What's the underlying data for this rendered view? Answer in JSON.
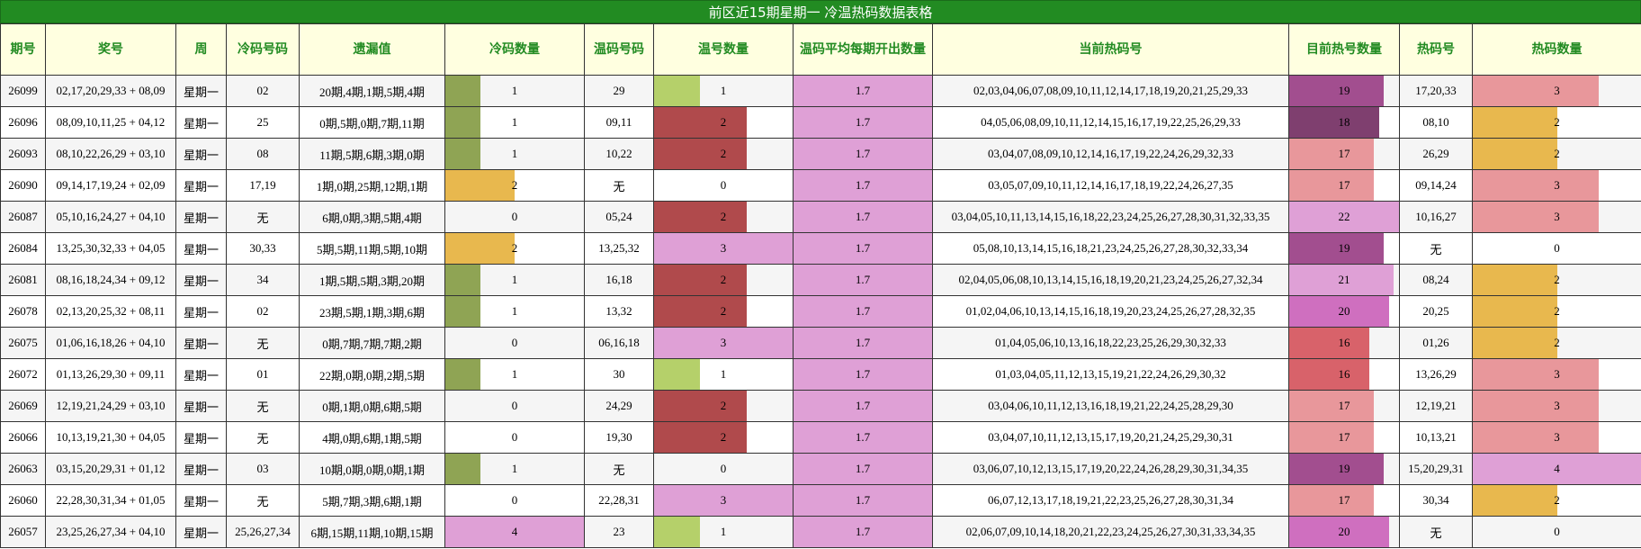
{
  "title": "前区近15期星期一 冷温热码数据表格",
  "headers": [
    "期号",
    "奖号",
    "周",
    "冷码号码",
    "遗漏值",
    "冷码数量",
    "温码号码",
    "温号数量",
    "温码平均每期开出数量",
    "当前热码号",
    "目前热号数量",
    "热码号",
    "热码数量"
  ],
  "palette": {
    "cold": {
      "1": "#8FA454",
      "2": "#E8B84E",
      "4": "#DFA0D6"
    },
    "warm": {
      "1": "#B5D06A",
      "2": "#B04A4C",
      "3": "#DFA0D6"
    },
    "warm_avg": "#DFA0D6",
    "cur_hot": {
      "16": "#D8626A",
      "17": "#E8979B",
      "18": "#7F3F6F",
      "19": "#A24E8F",
      "20": "#CF6FBF",
      "21": "#DFA0D6",
      "22": "#DFA0D6"
    },
    "hot": {
      "2": "#E8B84E",
      "3": "#E8979B",
      "4": "#DFA0D6"
    }
  },
  "chart_data": {
    "type": "table",
    "title": "前区近15期星期一 冷温热码数据表格",
    "rows": [
      {
        "issue": "26099",
        "numbers": "02,17,20,29,33 + 08,09",
        "week": "星期一",
        "cold_nums": "02",
        "omission": "20期,4期,1期,5期,4期",
        "cold_count": 1,
        "warm_nums": "29",
        "warm_count": 1,
        "warm_avg": "1.7",
        "cur_hot": "02,03,04,06,07,08,09,10,11,12,14,17,18,19,20,21,25,29,33",
        "cur_hot_count": 19,
        "hot_nums": "17,20,33",
        "hot_count": 3
      },
      {
        "issue": "26096",
        "numbers": "08,09,10,11,25 + 04,12",
        "week": "星期一",
        "cold_nums": "25",
        "omission": "0期,5期,0期,7期,11期",
        "cold_count": 1,
        "warm_nums": "09,11",
        "warm_count": 2,
        "warm_avg": "1.7",
        "cur_hot": "04,05,06,08,09,10,11,12,14,15,16,17,19,22,25,26,29,33",
        "cur_hot_count": 18,
        "hot_nums": "08,10",
        "hot_count": 2
      },
      {
        "issue": "26093",
        "numbers": "08,10,22,26,29 + 03,10",
        "week": "星期一",
        "cold_nums": "08",
        "omission": "11期,5期,6期,3期,0期",
        "cold_count": 1,
        "warm_nums": "10,22",
        "warm_count": 2,
        "warm_avg": "1.7",
        "cur_hot": "03,04,07,08,09,10,12,14,16,17,19,22,24,26,29,32,33",
        "cur_hot_count": 17,
        "hot_nums": "26,29",
        "hot_count": 2
      },
      {
        "issue": "26090",
        "numbers": "09,14,17,19,24 + 02,09",
        "week": "星期一",
        "cold_nums": "17,19",
        "omission": "1期,0期,25期,12期,1期",
        "cold_count": 2,
        "warm_nums": "无",
        "warm_count": 0,
        "warm_avg": "1.7",
        "cur_hot": "03,05,07,09,10,11,12,14,16,17,18,19,22,24,26,27,35",
        "cur_hot_count": 17,
        "hot_nums": "09,14,24",
        "hot_count": 3
      },
      {
        "issue": "26087",
        "numbers": "05,10,16,24,27 + 04,10",
        "week": "星期一",
        "cold_nums": "无",
        "omission": "6期,0期,3期,5期,4期",
        "cold_count": 0,
        "warm_nums": "05,24",
        "warm_count": 2,
        "warm_avg": "1.7",
        "cur_hot": "03,04,05,10,11,13,14,15,16,18,22,23,24,25,26,27,28,30,31,32,33,35",
        "cur_hot_count": 22,
        "hot_nums": "10,16,27",
        "hot_count": 3
      },
      {
        "issue": "26084",
        "numbers": "13,25,30,32,33 + 04,05",
        "week": "星期一",
        "cold_nums": "30,33",
        "omission": "5期,5期,11期,5期,10期",
        "cold_count": 2,
        "warm_nums": "13,25,32",
        "warm_count": 3,
        "warm_avg": "1.7",
        "cur_hot": "05,08,10,13,14,15,16,18,21,23,24,25,26,27,28,30,32,33,34",
        "cur_hot_count": 19,
        "hot_nums": "无",
        "hot_count": 0
      },
      {
        "issue": "26081",
        "numbers": "08,16,18,24,34 + 09,12",
        "week": "星期一",
        "cold_nums": "34",
        "omission": "1期,5期,5期,3期,20期",
        "cold_count": 1,
        "warm_nums": "16,18",
        "warm_count": 2,
        "warm_avg": "1.7",
        "cur_hot": "02,04,05,06,08,10,13,14,15,16,18,19,20,21,23,24,25,26,27,32,34",
        "cur_hot_count": 21,
        "hot_nums": "08,24",
        "hot_count": 2
      },
      {
        "issue": "26078",
        "numbers": "02,13,20,25,32 + 08,11",
        "week": "星期一",
        "cold_nums": "02",
        "omission": "23期,5期,1期,3期,6期",
        "cold_count": 1,
        "warm_nums": "13,32",
        "warm_count": 2,
        "warm_avg": "1.7",
        "cur_hot": "01,02,04,06,10,13,14,15,16,18,19,20,23,24,25,26,27,28,32,35",
        "cur_hot_count": 20,
        "hot_nums": "20,25",
        "hot_count": 2
      },
      {
        "issue": "26075",
        "numbers": "01,06,16,18,26 + 04,10",
        "week": "星期一",
        "cold_nums": "无",
        "omission": "0期,7期,7期,7期,2期",
        "cold_count": 0,
        "warm_nums": "06,16,18",
        "warm_count": 3,
        "warm_avg": "1.7",
        "cur_hot": "01,04,05,06,10,13,16,18,22,23,25,26,29,30,32,33",
        "cur_hot_count": 16,
        "hot_nums": "01,26",
        "hot_count": 2
      },
      {
        "issue": "26072",
        "numbers": "01,13,26,29,30 + 09,11",
        "week": "星期一",
        "cold_nums": "01",
        "omission": "22期,0期,0期,2期,5期",
        "cold_count": 1,
        "warm_nums": "30",
        "warm_count": 1,
        "warm_avg": "1.7",
        "cur_hot": "01,03,04,05,11,12,13,15,19,21,22,24,26,29,30,32",
        "cur_hot_count": 16,
        "hot_nums": "13,26,29",
        "hot_count": 3
      },
      {
        "issue": "26069",
        "numbers": "12,19,21,24,29 + 03,10",
        "week": "星期一",
        "cold_nums": "无",
        "omission": "0期,1期,0期,6期,5期",
        "cold_count": 0,
        "warm_nums": "24,29",
        "warm_count": 2,
        "warm_avg": "1.7",
        "cur_hot": "03,04,06,10,11,12,13,16,18,19,21,22,24,25,28,29,30",
        "cur_hot_count": 17,
        "hot_nums": "12,19,21",
        "hot_count": 3
      },
      {
        "issue": "26066",
        "numbers": "10,13,19,21,30 + 04,05",
        "week": "星期一",
        "cold_nums": "无",
        "omission": "4期,0期,6期,1期,5期",
        "cold_count": 0,
        "warm_nums": "19,30",
        "warm_count": 2,
        "warm_avg": "1.7",
        "cur_hot": "03,04,07,10,11,12,13,15,17,19,20,21,24,25,29,30,31",
        "cur_hot_count": 17,
        "hot_nums": "10,13,21",
        "hot_count": 3
      },
      {
        "issue": "26063",
        "numbers": "03,15,20,29,31 + 01,12",
        "week": "星期一",
        "cold_nums": "03",
        "omission": "10期,0期,0期,0期,1期",
        "cold_count": 1,
        "warm_nums": "无",
        "warm_count": 0,
        "warm_avg": "1.7",
        "cur_hot": "03,06,07,10,12,13,15,17,19,20,22,24,26,28,29,30,31,34,35",
        "cur_hot_count": 19,
        "hot_nums": "15,20,29,31",
        "hot_count": 4
      },
      {
        "issue": "26060",
        "numbers": "22,28,30,31,34 + 01,05",
        "week": "星期一",
        "cold_nums": "无",
        "omission": "5期,7期,3期,6期,1期",
        "cold_count": 0,
        "warm_nums": "22,28,31",
        "warm_count": 3,
        "warm_avg": "1.7",
        "cur_hot": "06,07,12,13,17,18,19,21,22,23,25,26,27,28,30,31,34",
        "cur_hot_count": 17,
        "hot_nums": "30,34",
        "hot_count": 2
      },
      {
        "issue": "26057",
        "numbers": "23,25,26,27,34 + 04,10",
        "week": "星期一",
        "cold_nums": "25,26,27,34",
        "omission": "6期,15期,11期,10期,15期",
        "cold_count": 4,
        "warm_nums": "23",
        "warm_count": 1,
        "warm_avg": "1.7",
        "cur_hot": "02,06,07,09,10,14,18,20,21,22,23,24,25,26,27,30,31,33,34,35",
        "cur_hot_count": 20,
        "hot_nums": "无",
        "hot_count": 0
      }
    ],
    "bar_scales": {
      "cold_count": [
        0,
        4
      ],
      "warm_count": [
        0,
        3
      ],
      "warm_avg": [
        0,
        1.7
      ],
      "cur_hot_count": [
        0,
        22
      ],
      "hot_count": [
        0,
        4
      ]
    }
  }
}
